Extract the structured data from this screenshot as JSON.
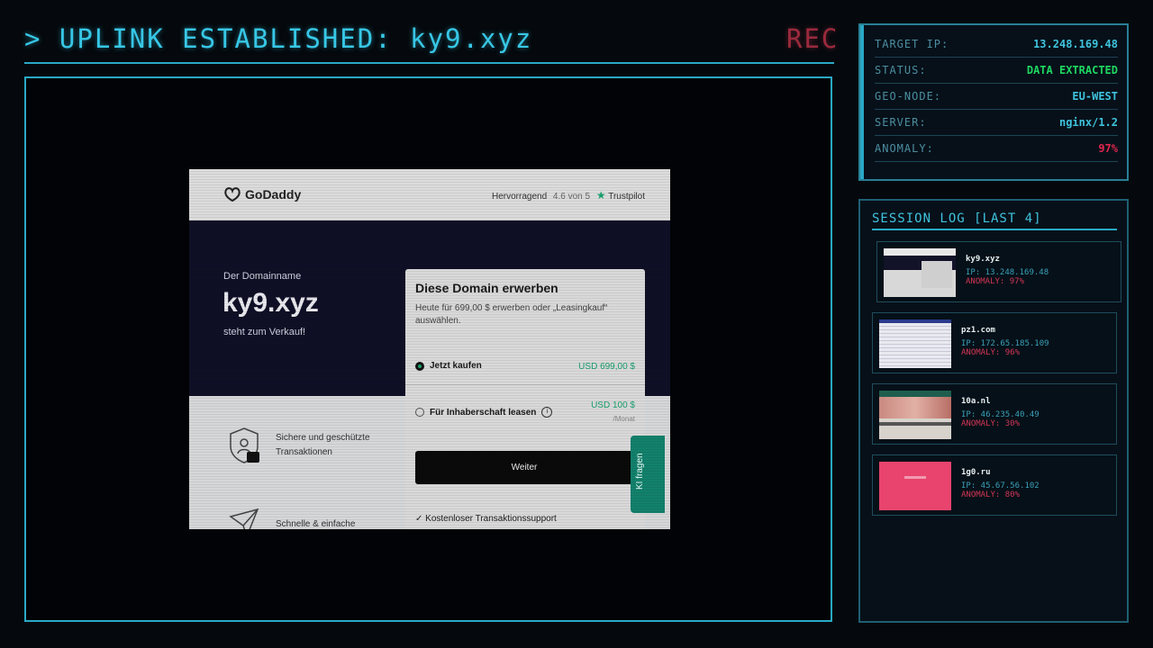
{
  "header": {
    "title": "> UPLINK ESTABLISHED: ky9.xyz",
    "rec": "REC"
  },
  "colors": {
    "accent": "#2aa9c6",
    "ok": "#1ed760",
    "alert": "#e0254d",
    "site_green": "#1aa06d"
  },
  "info": {
    "rows": [
      {
        "key": "TARGET IP:",
        "value": "13.248.169.48",
        "color": "#3fc3dd"
      },
      {
        "key": "STATUS:",
        "value": "DATA EXTRACTED",
        "color": "#1ed760"
      },
      {
        "key": "GEO-NODE:",
        "value": "EU-WEST",
        "color": "#3fc3dd"
      },
      {
        "key": "SERVER:",
        "value": "nginx/1.2",
        "color": "#3fc3dd"
      },
      {
        "key": "ANOMALY:",
        "value": "97%",
        "color": "#e0254d"
      }
    ]
  },
  "site": {
    "logo": "GoDaddy",
    "trustpilot": {
      "rating_label": "Hervorragend",
      "score": "4.6 von 5",
      "brand": "Trustpilot"
    },
    "hero": {
      "subtitle": "Der Domainname",
      "domain": "ky9.xyz",
      "sale_text": "steht zum Verkauf!"
    },
    "card": {
      "title": "Diese Domain erwerben",
      "description": "Heute für 699,00 $ erwerben oder „Leasingkauf“ auswählen.",
      "option_buy": {
        "label": "Jetzt kaufen",
        "price": "USD 699,00 $",
        "selected": true
      },
      "option_lease": {
        "label": "Für Inhaberschaft leasen",
        "price": "USD 100 $",
        "period": "/Monat",
        "selected": false
      },
      "button": "Weiter",
      "support": "Kostenloser Transaktionssupport"
    },
    "features": [
      {
        "icon": "shield-icon",
        "text1": "Sichere und geschützte",
        "text2": "Transaktionen"
      },
      {
        "icon": "paper-plane-icon",
        "text1": "Schnelle & einfache",
        "text2": ""
      }
    ],
    "ki_tab": "KI fragen"
  },
  "log": {
    "title": "SESSION LOG [LAST 4]",
    "entries": [
      {
        "name": "ky9.xyz",
        "ip": "IP: 13.248.169.48",
        "anomaly": "ANOMALY: 97%"
      },
      {
        "name": "pz1.com",
        "ip": "IP: 172.65.185.109",
        "anomaly": "ANOMALY: 96%"
      },
      {
        "name": "10a.nl",
        "ip": "IP: 46.235.40.49",
        "anomaly": "ANOMALY: 30%"
      },
      {
        "name": "1g0.ru",
        "ip": "IP: 45.67.56.102",
        "anomaly": "ANOMALY: 80%"
      }
    ]
  }
}
